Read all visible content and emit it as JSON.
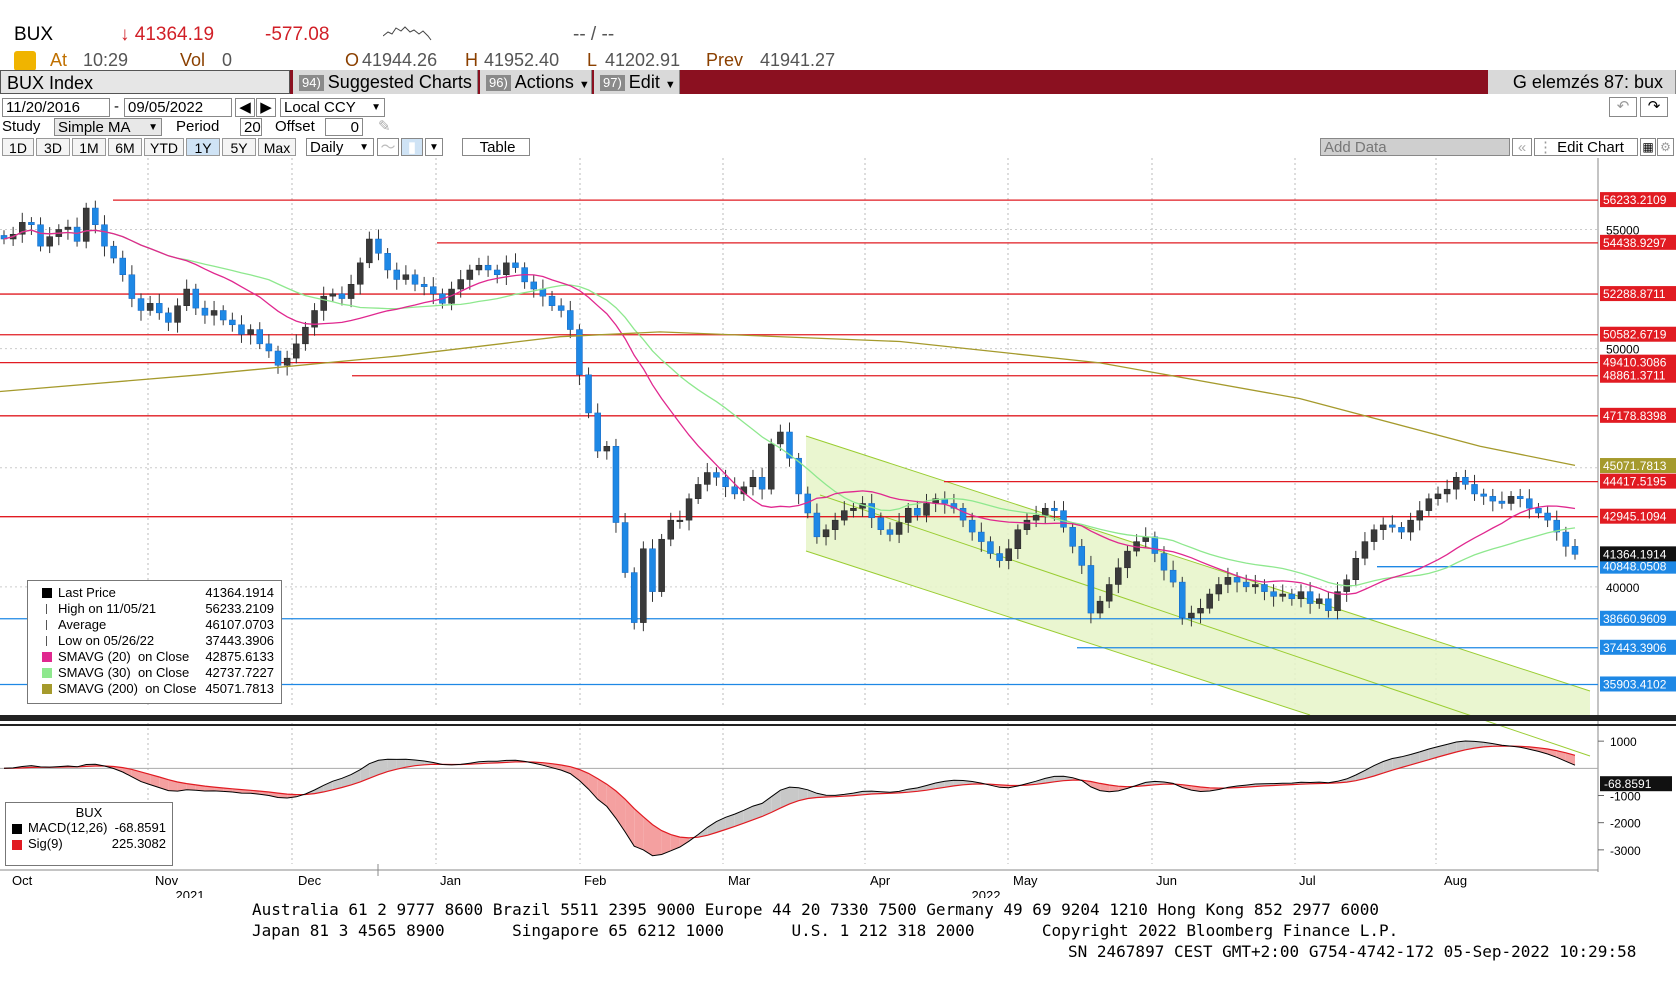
{
  "header": {
    "ticker": "BUX",
    "last_arrow": "↓",
    "last": "41364.19",
    "change": "-577.08",
    "bid_ask": "-- / --",
    "at_label": "At",
    "time": "10:29",
    "vol_label": "Vol",
    "vol": "0",
    "o_label": "O",
    "open": "41944.26",
    "h_label": "H",
    "high": "41952.40",
    "l_label": "L",
    "low": "41202.91",
    "prev_label": "Prev",
    "prev": "41941.27"
  },
  "toolbar": {
    "security": "BUX Index",
    "btn1_num": "94)",
    "btn1": "Suggested Charts",
    "btn2_num": "96)",
    "btn2": "Actions",
    "btn3_num": "97)",
    "btn3": "Edit",
    "right_title": "G elemzés 87: bux"
  },
  "controls": {
    "date_from": "11/20/2016",
    "date_sep": "-",
    "date_to": "09/05/2022",
    "currency": "Local CCY",
    "study_label": "Study",
    "study": "Simple MA",
    "period_label": "Period",
    "period": "20",
    "offset_label": "Offset",
    "offset": "0",
    "ranges": [
      "1D",
      "3D",
      "1M",
      "6M",
      "YTD",
      "1Y",
      "5Y",
      "Max"
    ],
    "active_range": "1Y",
    "frequency": "Daily",
    "table": "Table",
    "add_data": "Add Data",
    "edit_chart": "Edit Chart"
  },
  "colors": {
    "up": "#3a3a3a",
    "down": "#1e88e5",
    "hline_red": "#e11b22",
    "hline_blue": "#1e88e5",
    "sma20": "#e0288f",
    "sma30": "#8ee88e",
    "sma200": "#a59a2c",
    "channel": "#9acd32",
    "macd": "#000000",
    "signal": "#e11b22"
  },
  "legend": [
    {
      "label": "Last Price",
      "value": "41364.1914",
      "icon": "candle"
    },
    {
      "label": "High on 11/05/21",
      "value": "56233.2109",
      "icon": "high-marker"
    },
    {
      "label": "Average",
      "value": "46107.0703",
      "icon": "average-marker"
    },
    {
      "label": "Low on 05/26/22",
      "value": "37443.3906",
      "icon": "low-marker"
    },
    {
      "label": "SMAVG (20)  on Close",
      "value": "42875.6133",
      "icon": "swatch-magenta"
    },
    {
      "label": "SMAVG (30)  on Close",
      "value": "42737.7227",
      "icon": "swatch-green"
    },
    {
      "label": "SMAVG (200)  on Close",
      "value": "45071.7813",
      "icon": "swatch-olive"
    }
  ],
  "macd_legend": {
    "title": "BUX",
    "macd_label": "MACD(12,26)",
    "macd_value": "-68.8591",
    "sig_label": "Sig(9)",
    "sig_value": "225.3082"
  },
  "chart_data": {
    "type": "candlestick",
    "title": "BUX Index",
    "y_axis_ticks": [
      40000,
      45000,
      50000,
      55000
    ],
    "ylim": [
      35000,
      58000
    ],
    "x_months": [
      "Oct",
      "Nov",
      "Dec",
      "Jan",
      "Feb",
      "Mar",
      "Apr",
      "May",
      "Jun",
      "Jul",
      "Aug"
    ],
    "x_years": [
      "2021",
      "2022"
    ],
    "price_lines": [
      {
        "value": "56233.2109",
        "color": "red"
      },
      {
        "value": "54438.9297",
        "color": "red"
      },
      {
        "value": "52288.8711",
        "color": "red"
      },
      {
        "value": "50582.6719",
        "color": "red"
      },
      {
        "value": "49410.3086",
        "color": "red"
      },
      {
        "value": "48861.3711",
        "color": "red"
      },
      {
        "value": "47178.8398",
        "color": "red"
      },
      {
        "value": "44417.5195",
        "color": "red"
      },
      {
        "value": "42945.1094",
        "color": "red"
      },
      {
        "value": "40848.0508",
        "color": "blue"
      },
      {
        "value": "38660.9609",
        "color": "blue"
      },
      {
        "value": "37443.3906",
        "color": "blue"
      },
      {
        "value": "35903.4102",
        "color": "blue"
      }
    ],
    "axis_tags": [
      {
        "value": "45071.7813",
        "color": "olive"
      },
      {
        "value": "41364.1914",
        "color": "black"
      }
    ],
    "close_series_approx": [
      54600,
      54800,
      55300,
      55200,
      54300,
      54700,
      55000,
      55100,
      54500,
      55900,
      55200,
      54300,
      53800,
      53100,
      52100,
      51600,
      51900,
      51500,
      51100,
      51800,
      52500,
      51700,
      51400,
      51600,
      51200,
      51000,
      50600,
      50800,
      50200,
      49900,
      49300,
      49600,
      50200,
      50900,
      51600,
      52200,
      52300,
      52100,
      52700,
      53600,
      54600,
      54000,
      53300,
      52900,
      53100,
      52700,
      52600,
      52300,
      51900,
      52500,
      52900,
      53300,
      53500,
      53300,
      53100,
      53600,
      53400,
      52800,
      52500,
      52200,
      51800,
      51600,
      50800,
      48900,
      47300,
      45700,
      45900,
      42700,
      40600,
      38500,
      41600,
      39800,
      42000,
      42800,
      42800,
      43700,
      44300,
      44800,
      44600,
      44200,
      43900,
      44200,
      44600,
      44100,
      46000,
      46500,
      45400,
      43900,
      43100,
      42100,
      42400,
      42800,
      43200,
      43300,
      43500,
      42900,
      42400,
      42200,
      42700,
      43300,
      43000,
      43500,
      43700,
      43500,
      43300,
      42800,
      42300,
      41900,
      41400,
      41100,
      41600,
      42400,
      42800,
      43000,
      43300,
      43200,
      42500,
      41700,
      40900,
      38900,
      39400,
      40100,
      40800,
      41500,
      41900,
      42100,
      41400,
      40700,
      40200,
      38700,
      38900,
      39100,
      39700,
      40100,
      40400,
      40200,
      40000,
      40100,
      39800,
      39600,
      39700,
      39500,
      39800,
      39300,
      39500,
      39000,
      39800,
      40300,
      41200,
      41900,
      42400,
      42600,
      42500,
      42300,
      42800,
      43200,
      43700,
      43900,
      44100,
      44600,
      44300,
      43900,
      43800,
      43600,
      43500,
      43800,
      43700,
      43300,
      43100,
      42800,
      42300,
      41700,
      41364
    ],
    "macd_axis_ticks": [
      1000,
      -1000,
      -2000,
      -3000
    ],
    "macd_value": "-68.8591",
    "signal_value": "225.3082"
  },
  "footer": {
    "line1": "Australia 61 2 9777 8600 Brazil 5511 2395 9000 Europe 44 20 7330 7500 Germany 49 69 9204 1210 Hong Kong 852 2977 6000",
    "line2": "Japan 81 3 4565 8900       Singapore 65 6212 1000       U.S. 1 212 318 2000       Copyright 2022 Bloomberg Finance L.P.",
    "line3": "SN 2467897 CEST GMT+2:00 G754-4742-172 05-Sep-2022 10:29:58"
  }
}
